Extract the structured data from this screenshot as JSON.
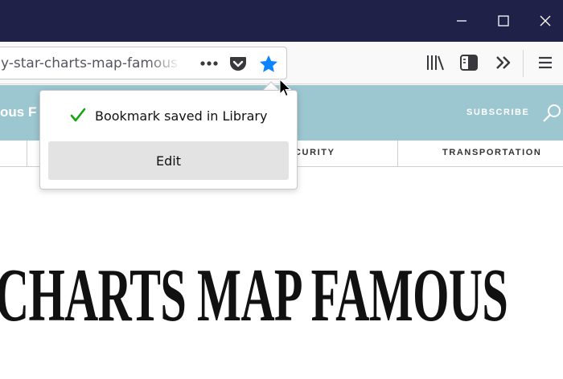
{
  "browser": {
    "url_text": "y-star-charts-map-famous",
    "page_actions_icon": "more-dots-icon",
    "pocket_icon": "pocket-icon",
    "bookmark_icon": "star-filled-icon",
    "bookmark_color": "#0a84ff"
  },
  "toolbar": {
    "library_icon": "library-icon",
    "sidebar_icon": "sidebar-icon",
    "overflow_icon": "chevron-double-right-icon",
    "menu_icon": "hamburger-menu-icon"
  },
  "window_controls": [
    "minimize-icon",
    "maximize-icon",
    "close-icon"
  ],
  "bookmark_panel": {
    "message": "Bookmark saved in Library",
    "edit_label": "Edit",
    "check_color": "#12a712"
  },
  "site": {
    "name_fragment": "ous F",
    "subscribe_label": "SUBSCRIBE",
    "header_color": "#9cc6d0",
    "categories": [
      "CURITY",
      "TRANSPORTATION"
    ]
  },
  "article": {
    "headline": "CHARTS MAP FAMOUS"
  }
}
